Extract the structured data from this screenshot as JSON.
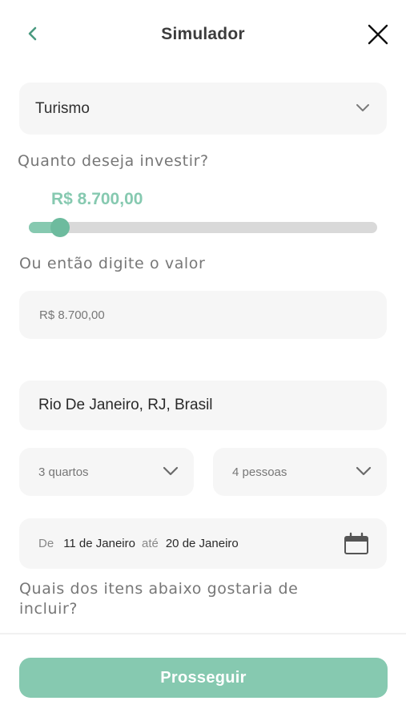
{
  "header": {
    "title": "Simulador"
  },
  "category_select": {
    "selected": "Turismo"
  },
  "investment": {
    "question": "Quanto deseja investir?",
    "amount_display": "R$ 8.700,00",
    "slider_level_fraction": 0.09,
    "alt_label": "Ou então digite o valor",
    "input_value": "R$ 8.700,00"
  },
  "location": {
    "value": "Rio De Janeiro, RJ, Brasil"
  },
  "rooms": {
    "selected": "3 quartos"
  },
  "people": {
    "selected": "4 pessoas"
  },
  "dates": {
    "from_label": "De",
    "from_value": "11 de Janeiro",
    "to_label": "até",
    "to_value": "20 de Janeiro"
  },
  "items_question": {
    "line1": "Quais dos itens abaixo gostaria de",
    "line2": "incluir?"
  },
  "footer": {
    "proceed_label": "Prosseguir"
  },
  "colors": {
    "accent": "#86c9b0",
    "thumb": "#6dbb9e",
    "field_bg": "#f6f6f6"
  },
  "icons": {
    "back": "chevron-left-icon",
    "close": "close-icon",
    "dropdown": "chevron-down-icon",
    "calendar": "calendar-icon"
  }
}
